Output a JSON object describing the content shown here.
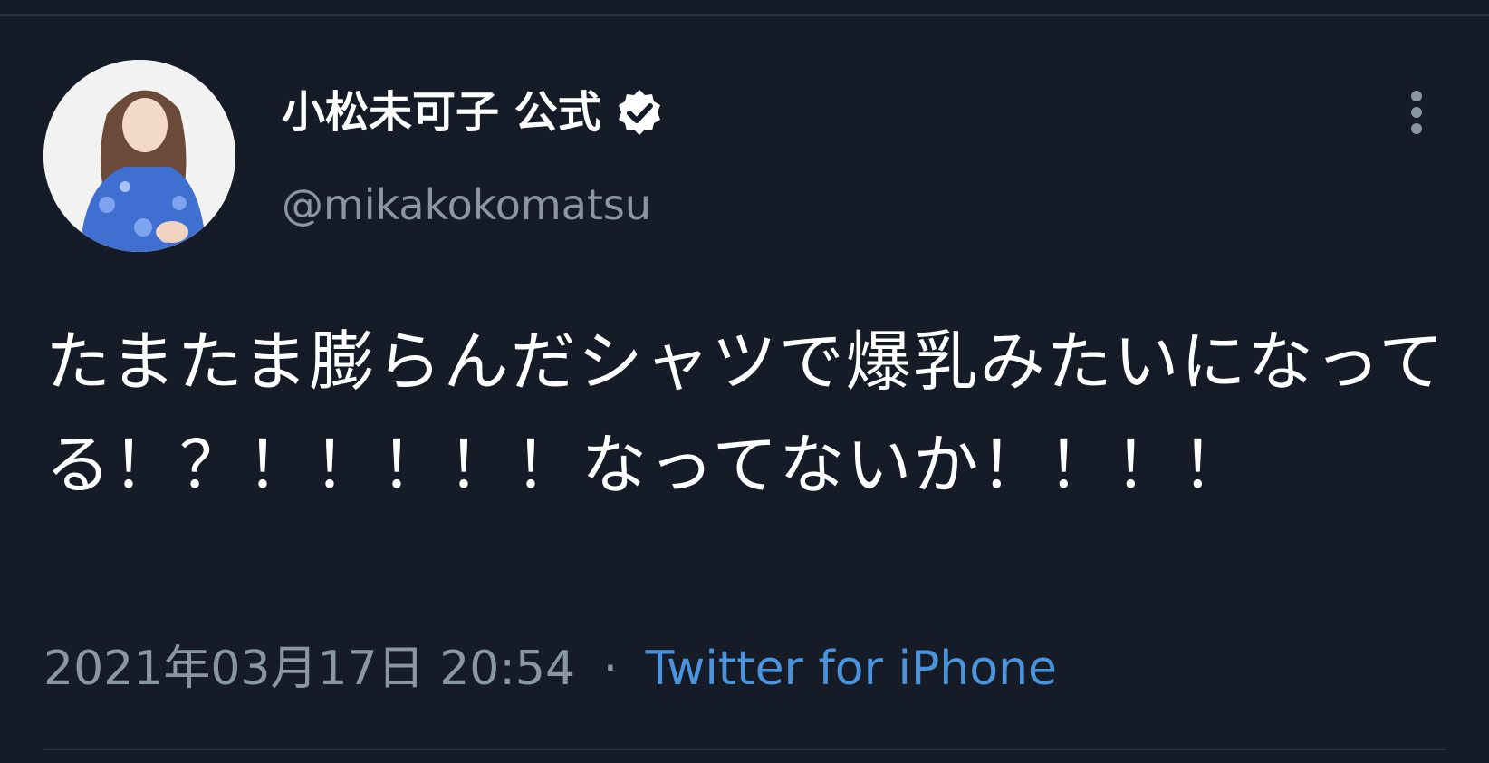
{
  "author": {
    "display_name": "小松未可子 公式",
    "handle": "@mikakokomatsu",
    "verified_icon": "verified-badge-icon",
    "avatar": "profile-photo"
  },
  "tweet": {
    "text": "たまたま膨らんだシャツで爆乳みたいになってる！？！！！！！なってないか！！！！"
  },
  "meta": {
    "timestamp": "2021年03月17日 20:54",
    "separator": "·",
    "source": "Twitter for iPhone"
  },
  "colors": {
    "background": "#161c27",
    "text": "#ffffff",
    "secondary_text": "#8b96a3",
    "link": "#4b93db",
    "divider": "#2a313d"
  },
  "icons": {
    "more": "more-vertical-icon"
  }
}
